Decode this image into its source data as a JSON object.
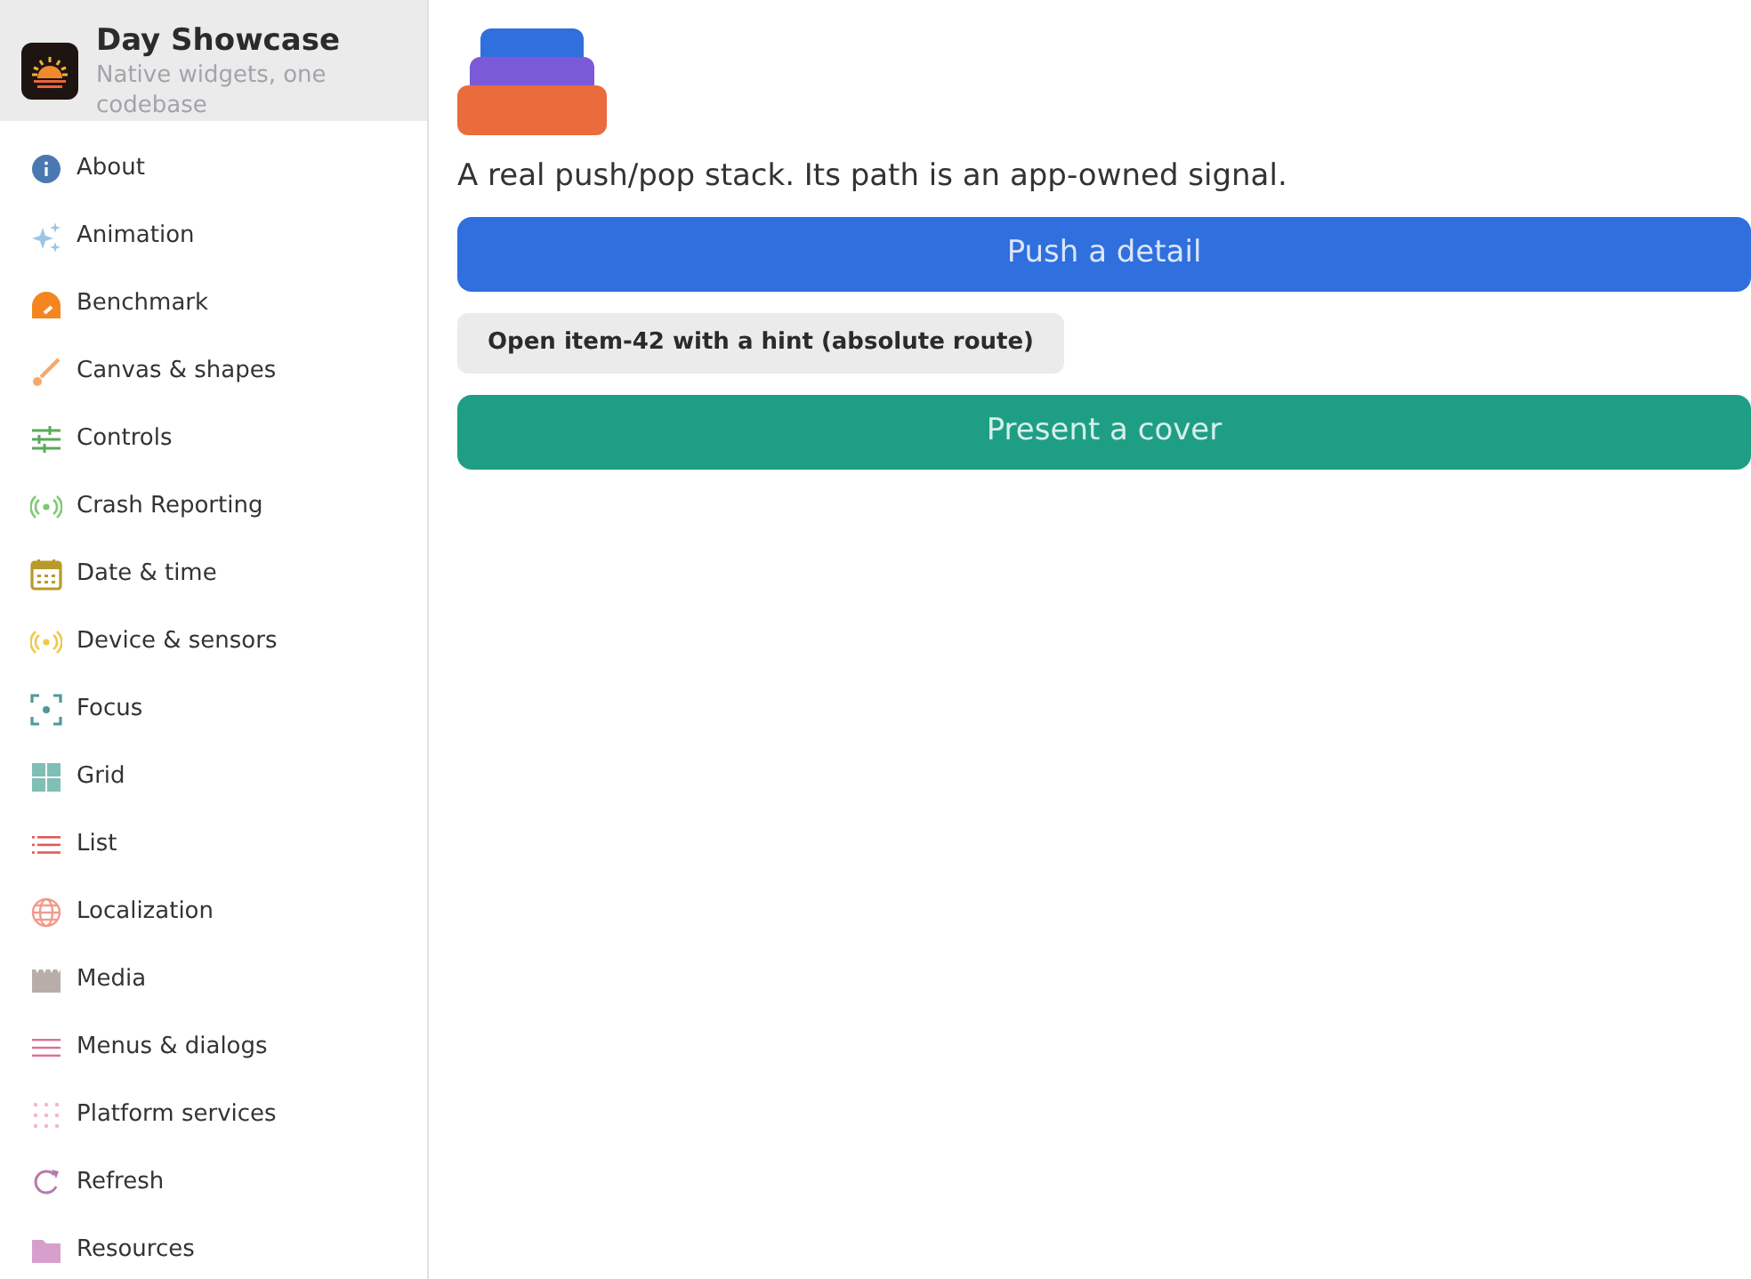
{
  "app": {
    "title": "Day Showcase",
    "subtitle": "Native widgets, one codebase"
  },
  "sidebar": {
    "items": [
      {
        "label": "About"
      },
      {
        "label": "Animation"
      },
      {
        "label": "Benchmark"
      },
      {
        "label": "Canvas & shapes"
      },
      {
        "label": "Controls"
      },
      {
        "label": "Crash Reporting"
      },
      {
        "label": "Date & time"
      },
      {
        "label": "Device & sensors"
      },
      {
        "label": "Focus"
      },
      {
        "label": "Grid"
      },
      {
        "label": "List"
      },
      {
        "label": "Localization"
      },
      {
        "label": "Media"
      },
      {
        "label": "Menus & dialogs"
      },
      {
        "label": "Platform services"
      },
      {
        "label": "Refresh"
      },
      {
        "label": "Resources"
      }
    ]
  },
  "content": {
    "description": "A real push/pop stack. Its path is an app-owned signal.",
    "buttons": [
      {
        "kind": "primary",
        "label": "Push a detail"
      },
      {
        "kind": "secondary",
        "label": "Open item-42 with a hint (absolute route)"
      },
      {
        "kind": "success",
        "label": "Present a cover"
      }
    ]
  }
}
